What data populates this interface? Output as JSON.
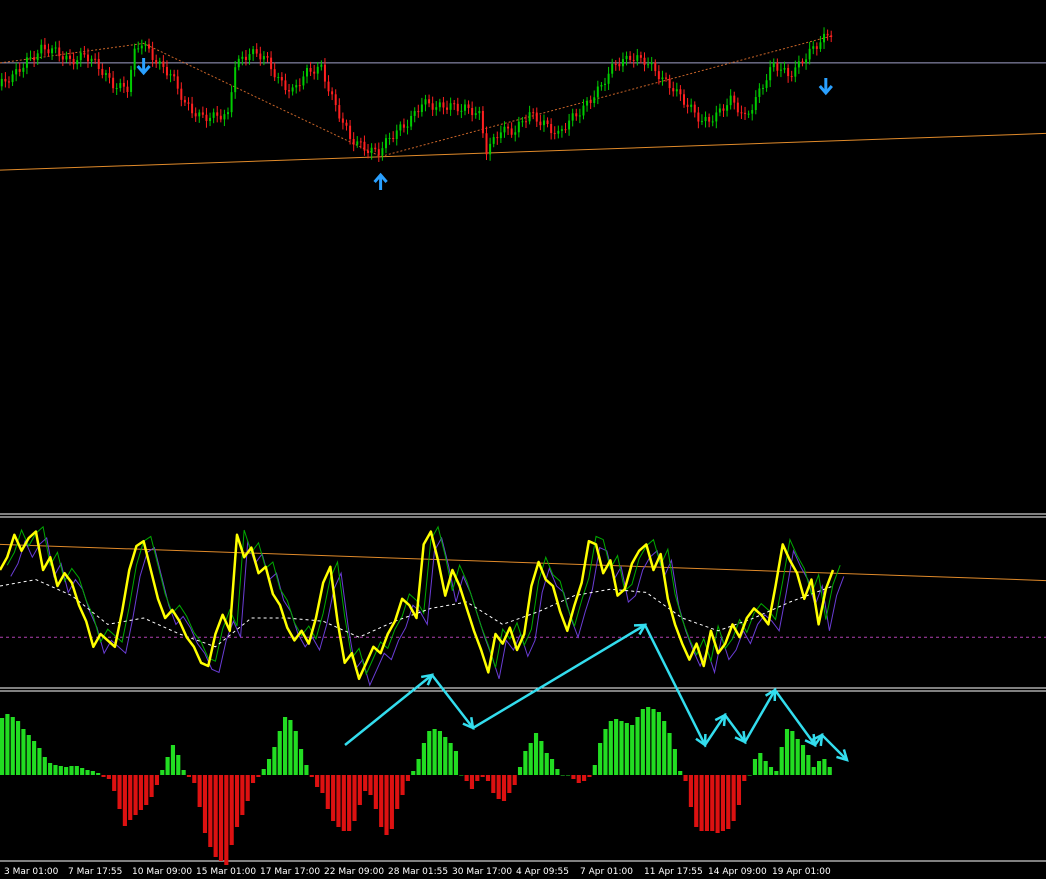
{
  "colors": {
    "background": "#000000",
    "bull_candle": "#00cc00",
    "bear_candle": "#ff2020",
    "price_level_line": "#a0a0c8",
    "trendline": "#e08a2a",
    "zigzag": "#c86428",
    "signal_arrow": "#2aa0ff",
    "oscillator_main": "#ffff00",
    "oscillator_green": "#00aa00",
    "oscillator_purple": "#6a3dd6",
    "oscillator_signal": "#ffffff",
    "oscillator_level": "#b040b0",
    "hist_positive": "#22dd22",
    "hist_negative": "#dd1111",
    "annotation_arrows": "#33ddee",
    "panel_separator": "#ffffff"
  },
  "icons": {
    "top_signal": "down-arrow-icon",
    "bottom_signal": "up-arrow-icon"
  },
  "chart_data": [
    {
      "type": "candlestick",
      "title": "",
      "xlabel": "",
      "ylabel": "",
      "ylim": [
        0,
        100
      ],
      "close_path": [
        [
          0,
          66
        ],
        [
          4,
          70
        ],
        [
          8,
          80
        ],
        [
          12,
          85
        ],
        [
          16,
          83
        ],
        [
          20,
          80
        ],
        [
          24,
          82
        ],
        [
          28,
          75
        ],
        [
          32,
          68
        ],
        [
          36,
          65
        ],
        [
          38,
          82
        ],
        [
          40,
          88
        ],
        [
          44,
          80
        ],
        [
          48,
          72
        ],
        [
          52,
          56
        ],
        [
          56,
          52
        ],
        [
          60,
          50
        ],
        [
          64,
          50
        ],
        [
          66,
          78
        ],
        [
          70,
          84
        ],
        [
          74,
          80
        ],
        [
          78,
          70
        ],
        [
          82,
          64
        ],
        [
          86,
          72
        ],
        [
          90,
          76
        ],
        [
          94,
          56
        ],
        [
          98,
          38
        ],
        [
          102,
          35
        ],
        [
          106,
          33
        ],
        [
          110,
          40
        ],
        [
          114,
          48
        ],
        [
          118,
          58
        ],
        [
          122,
          54
        ],
        [
          126,
          57
        ],
        [
          130,
          55
        ],
        [
          134,
          50
        ],
        [
          136,
          33
        ],
        [
          140,
          45
        ],
        [
          144,
          42
        ],
        [
          148,
          52
        ],
        [
          152,
          48
        ],
        [
          156,
          40
        ],
        [
          160,
          50
        ],
        [
          164,
          58
        ],
        [
          168,
          65
        ],
        [
          172,
          78
        ],
        [
          176,
          82
        ],
        [
          180,
          78
        ],
        [
          184,
          72
        ],
        [
          188,
          66
        ],
        [
          192,
          55
        ],
        [
          196,
          48
        ],
        [
          200,
          52
        ],
        [
          204,
          58
        ],
        [
          208,
          50
        ],
        [
          212,
          64
        ],
        [
          216,
          76
        ],
        [
          220,
          72
        ],
        [
          224,
          80
        ],
        [
          228,
          86
        ],
        [
          232,
          94
        ]
      ],
      "support_line": {
        "from": [
          0,
          23
        ],
        "to": [
          232,
          38
        ]
      },
      "resistance_line": {
        "value": 78
      },
      "zigzag": [
        [
          0,
          78
        ],
        [
          40,
          88
        ],
        [
          106,
          30
        ],
        [
          232,
          92
        ]
      ],
      "signals": [
        {
          "x": 40,
          "type": "sell",
          "icon": "down-arrow-icon"
        },
        {
          "x": 106,
          "type": "buy",
          "icon": "up-arrow-icon"
        },
        {
          "x": 230,
          "type": "sell",
          "icon": "down-arrow-icon"
        }
      ]
    },
    {
      "type": "line",
      "title": "",
      "ylim": [
        0,
        100
      ],
      "levels": [
        {
          "name": "",
          "value": 28
        }
      ],
      "baseline_slope": {
        "from": [
          0,
          86
        ],
        "to": [
          232,
          68
        ]
      },
      "series": [
        {
          "name": "",
          "style": "main",
          "points": [
            [
              0,
              70
            ],
            [
              2,
              78
            ],
            [
              4,
              92
            ],
            [
              6,
              82
            ],
            [
              8,
              90
            ],
            [
              10,
              94
            ],
            [
              12,
              70
            ],
            [
              14,
              78
            ],
            [
              16,
              60
            ],
            [
              18,
              68
            ],
            [
              20,
              62
            ],
            [
              22,
              48
            ],
            [
              24,
              38
            ],
            [
              26,
              22
            ],
            [
              28,
              30
            ],
            [
              30,
              26
            ],
            [
              32,
              22
            ],
            [
              34,
              44
            ],
            [
              36,
              70
            ],
            [
              38,
              85
            ],
            [
              40,
              88
            ],
            [
              42,
              70
            ],
            [
              44,
              52
            ],
            [
              46,
              40
            ],
            [
              48,
              45
            ],
            [
              50,
              38
            ],
            [
              52,
              28
            ],
            [
              54,
              22
            ],
            [
              56,
              12
            ],
            [
              58,
              10
            ],
            [
              60,
              30
            ],
            [
              62,
              42
            ],
            [
              64,
              32
            ],
            [
              66,
              92
            ],
            [
              68,
              78
            ],
            [
              70,
              84
            ],
            [
              72,
              68
            ],
            [
              74,
              72
            ],
            [
              76,
              55
            ],
            [
              78,
              48
            ],
            [
              80,
              34
            ],
            [
              82,
              26
            ],
            [
              84,
              32
            ],
            [
              86,
              24
            ],
            [
              88,
              40
            ],
            [
              90,
              62
            ],
            [
              92,
              72
            ],
            [
              94,
              38
            ],
            [
              96,
              12
            ],
            [
              98,
              18
            ],
            [
              100,
              2
            ],
            [
              102,
              12
            ],
            [
              104,
              22
            ],
            [
              106,
              18
            ],
            [
              108,
              30
            ],
            [
              110,
              38
            ],
            [
              112,
              52
            ],
            [
              114,
              48
            ],
            [
              116,
              40
            ],
            [
              118,
              86
            ],
            [
              120,
              94
            ],
            [
              122,
              76
            ],
            [
              124,
              54
            ],
            [
              126,
              70
            ],
            [
              128,
              60
            ],
            [
              130,
              46
            ],
            [
              132,
              32
            ],
            [
              134,
              20
            ],
            [
              136,
              6
            ],
            [
              138,
              30
            ],
            [
              140,
              24
            ],
            [
              142,
              34
            ],
            [
              144,
              20
            ],
            [
              146,
              30
            ],
            [
              148,
              60
            ],
            [
              150,
              75
            ],
            [
              152,
              64
            ],
            [
              154,
              60
            ],
            [
              156,
              44
            ],
            [
              158,
              32
            ],
            [
              160,
              48
            ],
            [
              162,
              62
            ],
            [
              164,
              88
            ],
            [
              166,
              86
            ],
            [
              168,
              68
            ],
            [
              170,
              76
            ],
            [
              172,
              54
            ],
            [
              174,
              58
            ],
            [
              176,
              74
            ],
            [
              178,
              82
            ],
            [
              180,
              86
            ],
            [
              182,
              70
            ],
            [
              184,
              80
            ],
            [
              186,
              52
            ],
            [
              188,
              36
            ],
            [
              190,
              24
            ],
            [
              192,
              14
            ],
            [
              194,
              24
            ],
            [
              196,
              10
            ],
            [
              198,
              32
            ],
            [
              200,
              18
            ],
            [
              202,
              24
            ],
            [
              204,
              36
            ],
            [
              206,
              28
            ],
            [
              208,
              40
            ],
            [
              210,
              46
            ],
            [
              212,
              42
            ],
            [
              214,
              36
            ],
            [
              216,
              60
            ],
            [
              218,
              86
            ],
            [
              220,
              76
            ],
            [
              222,
              68
            ],
            [
              224,
              52
            ],
            [
              226,
              64
            ],
            [
              228,
              36
            ],
            [
              230,
              58
            ],
            [
              232,
              70
            ]
          ]
        },
        {
          "name": "",
          "style": "signal",
          "points": [
            [
              0,
              60
            ],
            [
              10,
              64
            ],
            [
              20,
              54
            ],
            [
              30,
              36
            ],
            [
              40,
              40
            ],
            [
              50,
              30
            ],
            [
              60,
              22
            ],
            [
              70,
              40
            ],
            [
              80,
              40
            ],
            [
              90,
              38
            ],
            [
              100,
              28
            ],
            [
              110,
              38
            ],
            [
              120,
              46
            ],
            [
              130,
              50
            ],
            [
              140,
              36
            ],
            [
              150,
              44
            ],
            [
              160,
              54
            ],
            [
              170,
              58
            ],
            [
              180,
              56
            ],
            [
              190,
              40
            ],
            [
              200,
              32
            ],
            [
              210,
              40
            ],
            [
              220,
              50
            ],
            [
              232,
              60
            ]
          ]
        }
      ]
    },
    {
      "type": "bar",
      "title": "",
      "ylim": [
        -100,
        65
      ],
      "categories": [
        "3 Mar 01:00",
        "7 Mar 17:55",
        "10 Mar 09:00",
        "15 Mar 01:00",
        "17 Mar 17:00",
        "22 Mar 09:00",
        "28 Mar 01:55",
        "30 Mar 17:00",
        "4 Apr 09:55",
        "7 Apr 01:00",
        "11 Apr 17:55",
        "14 Apr 09:00",
        "19 Apr 01:00"
      ],
      "values": [
        57,
        61,
        58,
        54,
        46,
        40,
        34,
        27,
        18,
        12,
        10,
        9,
        8,
        9,
        9,
        7,
        5,
        4,
        2,
        -2,
        -4,
        -16,
        -34,
        -51,
        -45,
        -40,
        -35,
        -30,
        -22,
        -10,
        5,
        18,
        30,
        20,
        5,
        -2,
        -8,
        -32,
        -58,
        -72,
        -82,
        -86,
        -90,
        -70,
        -52,
        -40,
        -26,
        -8,
        -2,
        6,
        16,
        28,
        44,
        58,
        55,
        44,
        26,
        10,
        -2,
        -12,
        -18,
        -34,
        -46,
        -52,
        -56,
        -56,
        -46,
        -30,
        -16,
        -20,
        -34,
        -52,
        -60,
        -54,
        -34,
        -20,
        -6,
        4,
        16,
        32,
        44,
        46,
        44,
        38,
        32,
        24,
        0,
        -6,
        -14,
        -6,
        -2,
        -6,
        -18,
        -24,
        -26,
        -18,
        -10,
        8,
        24,
        32,
        42,
        34,
        22,
        16,
        6,
        0,
        0,
        -4,
        -8,
        -6,
        -2,
        10,
        32,
        46,
        54,
        56,
        54,
        52,
        50,
        58,
        66,
        68,
        66,
        63,
        54,
        42,
        26,
        4,
        -6,
        -32,
        -52,
        -56,
        -56,
        -56,
        -58,
        -56,
        -54,
        -46,
        -30,
        -6,
        0,
        16,
        22,
        14,
        8,
        4,
        28,
        46,
        44,
        36,
        30,
        20,
        8,
        14,
        16,
        8
      ]
    }
  ],
  "annotation": {
    "path": [
      [
        345,
        745
      ],
      [
        432,
        675
      ],
      [
        473,
        728
      ],
      [
        645,
        625
      ],
      [
        705,
        745
      ],
      [
        725,
        715
      ],
      [
        745,
        742
      ],
      [
        775,
        690
      ],
      [
        815,
        745
      ],
      [
        822,
        735
      ],
      [
        847,
        760
      ]
    ]
  },
  "axis": {
    "time_labels": [
      "3 Mar 01:00",
      "7 Mar 17:55",
      "10 Mar 09:00",
      "15 Mar 01:00",
      "17 Mar 17:00",
      "22 Mar 09:00",
      "28 Mar 01:55",
      "30 Mar 17:00",
      "4 Apr 09:55",
      "7 Apr 01:00",
      "11 Apr 17:55",
      "14 Apr 09:00",
      "19 Apr 01:00"
    ],
    "label_0": "3 Mar 01:00",
    "label_1": "7 Mar 17:55",
    "label_2": "10 Mar 09:00",
    "label_3": "15 Mar 01:00",
    "label_4": "17 Mar 17:00",
    "label_5": "22 Mar 09:00",
    "label_6": "28 Mar 01:55",
    "label_7": "30 Mar 17:00",
    "label_8": "4 Apr 09:55",
    "label_9": "7 Apr 01:00",
    "label_10": "11 Apr 17:55",
    "label_11": "14 Apr 09:00",
    "label_12": "19 Apr 01:00"
  }
}
